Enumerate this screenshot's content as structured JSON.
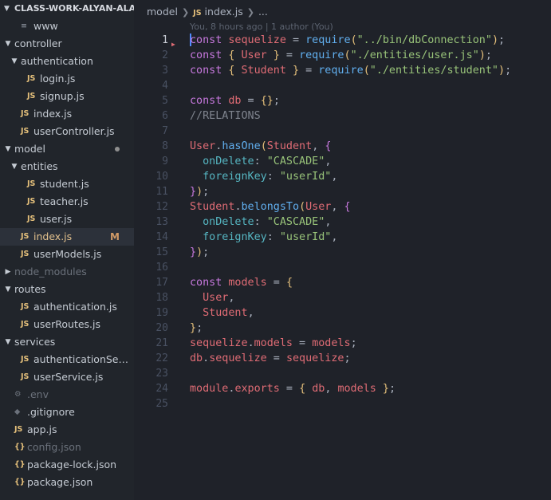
{
  "explorer": {
    "root_label": "CLASS-WORK-ALYAN-ALAM",
    "items": [
      {
        "label": "www",
        "icon": "menu",
        "depth": 1,
        "kind": "file"
      },
      {
        "label": "controller",
        "depth": 0,
        "kind": "folder-open"
      },
      {
        "label": "authentication",
        "depth": 1,
        "kind": "folder-open"
      },
      {
        "label": "login.js",
        "icon": "js",
        "depth": 2,
        "kind": "file"
      },
      {
        "label": "signup.js",
        "icon": "js",
        "depth": 2,
        "kind": "file"
      },
      {
        "label": "index.js",
        "icon": "js",
        "depth": 1,
        "kind": "file"
      },
      {
        "label": "userController.js",
        "icon": "js",
        "depth": 1,
        "kind": "file"
      },
      {
        "label": "model",
        "depth": 0,
        "kind": "folder-open",
        "status": "modified-dot"
      },
      {
        "label": "entities",
        "depth": 1,
        "kind": "folder-open"
      },
      {
        "label": "student.js",
        "icon": "js",
        "depth": 2,
        "kind": "file"
      },
      {
        "label": "teacher.js",
        "icon": "js",
        "depth": 2,
        "kind": "file"
      },
      {
        "label": "user.js",
        "icon": "js",
        "depth": 2,
        "kind": "file"
      },
      {
        "label": "index.js",
        "icon": "js",
        "depth": 1,
        "kind": "file",
        "active": true,
        "badge": "M"
      },
      {
        "label": "userModels.js",
        "icon": "js",
        "depth": 1,
        "kind": "file"
      },
      {
        "label": "node_modules",
        "depth": 0,
        "kind": "folder-closed",
        "dim": true
      },
      {
        "label": "routes",
        "depth": 0,
        "kind": "folder-open"
      },
      {
        "label": "authentication.js",
        "icon": "js",
        "depth": 1,
        "kind": "file"
      },
      {
        "label": "userRoutes.js",
        "icon": "js",
        "depth": 1,
        "kind": "file"
      },
      {
        "label": "services",
        "depth": 0,
        "kind": "folder-open"
      },
      {
        "label": "authenticationService.js",
        "icon": "js",
        "depth": 1,
        "kind": "file"
      },
      {
        "label": "userService.js",
        "icon": "js",
        "depth": 1,
        "kind": "file"
      },
      {
        "label": ".env",
        "icon": "gear",
        "depth": 0,
        "kind": "file",
        "dim": true
      },
      {
        "label": ".gitignore",
        "icon": "diamond",
        "depth": 0,
        "kind": "file"
      },
      {
        "label": "app.js",
        "icon": "js",
        "depth": 0,
        "kind": "file"
      },
      {
        "label": "config.json",
        "icon": "json",
        "depth": 0,
        "kind": "file",
        "dim": true
      },
      {
        "label": "package-lock.json",
        "icon": "json",
        "depth": 0,
        "kind": "file"
      },
      {
        "label": "package.json",
        "icon": "json",
        "depth": 0,
        "kind": "file"
      }
    ],
    "icons": {
      "js": "JS",
      "json": "{}",
      "menu": "≡",
      "gear": "⚙",
      "diamond": "◆"
    }
  },
  "breadcrumb": {
    "folder": "model",
    "file_icon": "JS",
    "file": "index.js",
    "more": "..."
  },
  "blame": "You, 8 hours ago | 1 author (You)",
  "editor": {
    "current_line": 1,
    "lines": [
      [
        [
          "keyword",
          "const "
        ],
        [
          "ident",
          "sequelize"
        ],
        [
          "punct",
          " = "
        ],
        [
          "func",
          "require"
        ],
        [
          "brace1",
          "("
        ],
        [
          "string",
          "\"../bin/dbConnection\""
        ],
        [
          "brace1",
          ")"
        ],
        [
          "punct",
          ";"
        ]
      ],
      [
        [
          "keyword",
          "const "
        ],
        [
          "brace1",
          "{ "
        ],
        [
          "ident",
          "User"
        ],
        [
          "brace1",
          " }"
        ],
        [
          "punct",
          " = "
        ],
        [
          "func",
          "require"
        ],
        [
          "brace1",
          "("
        ],
        [
          "string",
          "\"./entities/user.js\""
        ],
        [
          "brace1",
          ")"
        ],
        [
          "punct",
          ";"
        ]
      ],
      [
        [
          "keyword",
          "const "
        ],
        [
          "brace1",
          "{ "
        ],
        [
          "ident",
          "Student"
        ],
        [
          "brace1",
          " }"
        ],
        [
          "punct",
          " = "
        ],
        [
          "func",
          "require"
        ],
        [
          "brace1",
          "("
        ],
        [
          "string",
          "\"./entities/student\""
        ],
        [
          "brace1",
          ")"
        ],
        [
          "punct",
          ";"
        ]
      ],
      [],
      [
        [
          "keyword",
          "const "
        ],
        [
          "ident",
          "db"
        ],
        [
          "punct",
          " = "
        ],
        [
          "brace1",
          "{}"
        ],
        [
          "punct",
          ";"
        ]
      ],
      [
        [
          "comment",
          "//RELATIONS"
        ]
      ],
      [],
      [
        [
          "ident",
          "User"
        ],
        [
          "punct",
          "."
        ],
        [
          "func",
          "hasOne"
        ],
        [
          "brace1",
          "("
        ],
        [
          "ident",
          "Student"
        ],
        [
          "punct",
          ", "
        ],
        [
          "brace2",
          "{"
        ]
      ],
      [
        [
          "plain",
          "  "
        ],
        [
          "prop",
          "onDelete"
        ],
        [
          "punct",
          ": "
        ],
        [
          "string",
          "\"CASCADE\""
        ],
        [
          "punct",
          ","
        ]
      ],
      [
        [
          "plain",
          "  "
        ],
        [
          "prop",
          "foreignKey"
        ],
        [
          "punct",
          ": "
        ],
        [
          "string",
          "\"userId\""
        ],
        [
          "punct",
          ","
        ]
      ],
      [
        [
          "brace2",
          "}"
        ],
        [
          "brace1",
          ")"
        ],
        [
          "punct",
          ";"
        ]
      ],
      [
        [
          "ident",
          "Student"
        ],
        [
          "punct",
          "."
        ],
        [
          "func",
          "belongsTo"
        ],
        [
          "brace1",
          "("
        ],
        [
          "ident",
          "User"
        ],
        [
          "punct",
          ", "
        ],
        [
          "brace2",
          "{"
        ]
      ],
      [
        [
          "plain",
          "  "
        ],
        [
          "prop",
          "onDelete"
        ],
        [
          "punct",
          ": "
        ],
        [
          "string",
          "\"CASCADE\""
        ],
        [
          "punct",
          ","
        ]
      ],
      [
        [
          "plain",
          "  "
        ],
        [
          "prop",
          "foreignKey"
        ],
        [
          "punct",
          ": "
        ],
        [
          "string",
          "\"userId\""
        ],
        [
          "punct",
          ","
        ]
      ],
      [
        [
          "brace2",
          "}"
        ],
        [
          "brace1",
          ")"
        ],
        [
          "punct",
          ";"
        ]
      ],
      [],
      [
        [
          "keyword",
          "const "
        ],
        [
          "ident",
          "models"
        ],
        [
          "punct",
          " = "
        ],
        [
          "brace1",
          "{"
        ]
      ],
      [
        [
          "plain",
          "  "
        ],
        [
          "ident",
          "User"
        ],
        [
          "punct",
          ","
        ]
      ],
      [
        [
          "plain",
          "  "
        ],
        [
          "ident",
          "Student"
        ],
        [
          "punct",
          ","
        ]
      ],
      [
        [
          "brace1",
          "}"
        ],
        [
          "punct",
          ";"
        ]
      ],
      [
        [
          "ident",
          "sequelize"
        ],
        [
          "punct",
          "."
        ],
        [
          "ident",
          "models"
        ],
        [
          "punct",
          " = "
        ],
        [
          "ident",
          "models"
        ],
        [
          "punct",
          ";"
        ]
      ],
      [
        [
          "ident",
          "db"
        ],
        [
          "punct",
          "."
        ],
        [
          "ident",
          "sequelize"
        ],
        [
          "punct",
          " = "
        ],
        [
          "ident",
          "sequelize"
        ],
        [
          "punct",
          ";"
        ]
      ],
      [],
      [
        [
          "ident",
          "module"
        ],
        [
          "punct",
          "."
        ],
        [
          "ident",
          "exports"
        ],
        [
          "punct",
          " = "
        ],
        [
          "brace1",
          "{ "
        ],
        [
          "ident",
          "db"
        ],
        [
          "punct",
          ", "
        ],
        [
          "ident",
          "models"
        ],
        [
          "brace1",
          " }"
        ],
        [
          "punct",
          ";"
        ]
      ],
      []
    ]
  }
}
